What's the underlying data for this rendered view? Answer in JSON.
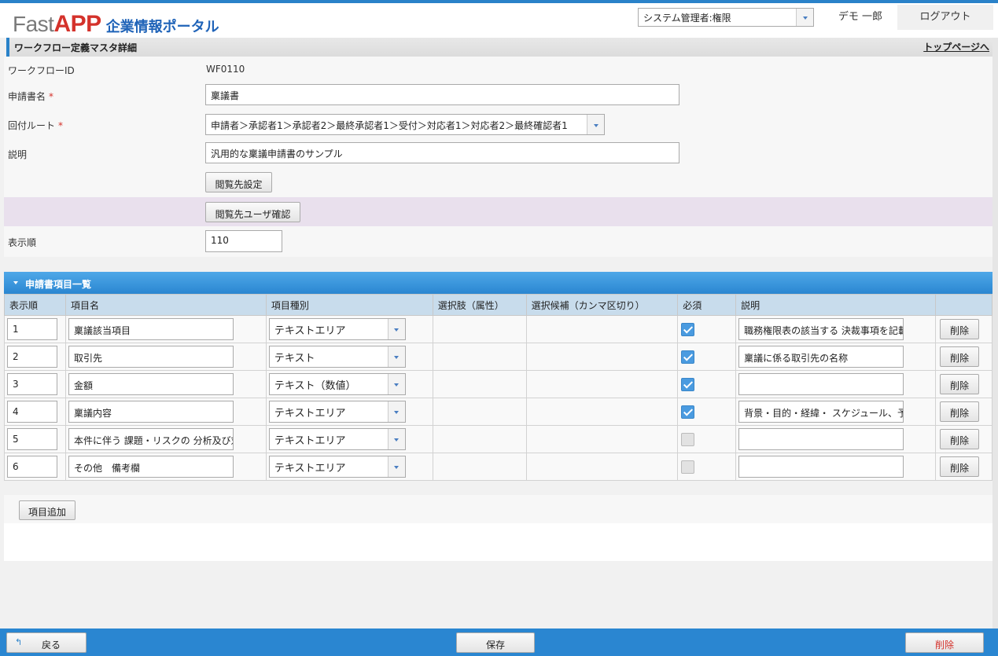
{
  "header": {
    "logo_fast": "Fast",
    "logo_app": "APP",
    "logo_portal": "企業情報ポータル",
    "role_select": "システム管理者:権限",
    "user_name": "デモ 一郎",
    "logout": "ログアウト"
  },
  "page": {
    "title": "ワークフロー定義マスタ詳細",
    "top_link": "トップページへ"
  },
  "form": {
    "workflow_id_label": "ワークフローID",
    "workflow_id_value": "WF0110",
    "app_name_label": "申請書名",
    "app_name_required": "*",
    "app_name_value": "稟議書",
    "route_label": "回付ルート",
    "route_required": "*",
    "route_value": "申請者＞承認者1＞承認者2＞最終承認者1＞受付＞対応者1＞対応者2＞最終確認者1",
    "desc_label": "説明",
    "desc_value": "汎用的な稟議申請書のサンプル",
    "viewer_setting_btn": "閲覧先設定",
    "viewer_confirm_btn": "閲覧先ユーザ確認",
    "order_label": "表示順",
    "order_value": "110"
  },
  "items_section": {
    "title": "申請書項目一覧",
    "columns": [
      "表示順",
      "項目名",
      "項目種別",
      "選択肢（属性）",
      "選択候補（カンマ区切り）",
      "必須",
      "説明",
      ""
    ],
    "rows": [
      {
        "order": "1",
        "name": "稟議該当項目",
        "type": "テキストエリア",
        "required": true,
        "desc": "職務権限表の該当する 決裁事項を記載",
        "delete": "削除"
      },
      {
        "order": "2",
        "name": "取引先",
        "type": "テキスト",
        "required": true,
        "desc": "稟議に係る取引先の名称",
        "delete": "削除"
      },
      {
        "order": "3",
        "name": "金額",
        "type": "テキスト（数値）",
        "required": true,
        "desc": "",
        "delete": "削除"
      },
      {
        "order": "4",
        "name": "稟議内容",
        "type": "テキストエリア",
        "required": true,
        "desc": "背景・目的・経緯・ スケジュール、予算",
        "delete": "削除"
      },
      {
        "order": "5",
        "name": "本件に伴う 課題・リスクの 分析及び対策",
        "type": "テキストエリア",
        "required": false,
        "desc": "",
        "delete": "削除"
      },
      {
        "order": "6",
        "name": "その他　備考欄",
        "type": "テキストエリア",
        "required": false,
        "desc": "",
        "delete": "削除"
      }
    ],
    "add_btn": "項目追加"
  },
  "footer": {
    "back": "戻る",
    "save": "保存",
    "delete": "削除"
  },
  "colors": {
    "accent": "#2a86d1",
    "brand_red": "#d4322b",
    "brand_blue": "#1f63b8",
    "delete_text": "#d4322b"
  }
}
